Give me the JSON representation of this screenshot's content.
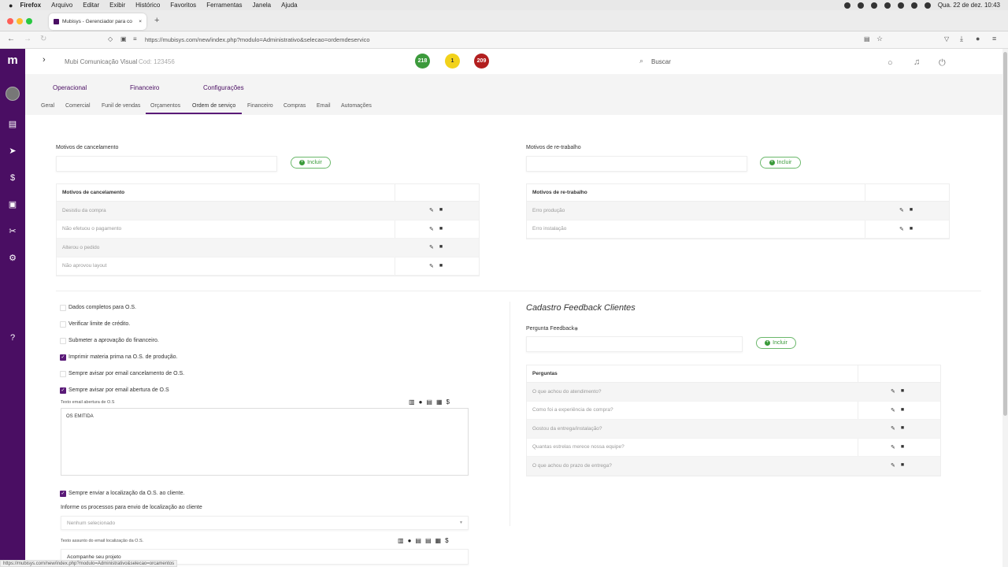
{
  "macos": {
    "app": "Firefox",
    "menus": [
      "Arquivo",
      "Editar",
      "Exibir",
      "Histórico",
      "Favoritos",
      "Ferramentas",
      "Janela",
      "Ajuda"
    ],
    "datetime": "Qua. 22 de dez.  10:43"
  },
  "browser": {
    "tab_title": "Mubisys - Gerenciador para co",
    "url": "https://mubisys.com/new/index.php?modulo=Administrativo&selecao=ordemdeservico",
    "status_url": "https://mubisys.com/new/index.php?modulo=Administrativo&selecao=orcamentos"
  },
  "header": {
    "company": "Mubi Comunicação Visual",
    "code": "Cod: 123456",
    "badges": [
      {
        "value": "218",
        "color": "#3c9a3c"
      },
      {
        "value": "1",
        "color": "#f2d21b"
      },
      {
        "value": "209",
        "color": "#b21f1f"
      }
    ],
    "search_label": "Buscar"
  },
  "topnav": [
    "Operacional",
    "Financeiro",
    "Configurações"
  ],
  "subnav": [
    "Geral",
    "Comercial",
    "Funil de vendas",
    "Orçamentos",
    "Ordem de serviço",
    "Financeiro",
    "Compras",
    "Email",
    "Automações"
  ],
  "active_subnav": "Ordem de serviço",
  "colors": {
    "brand": "#4a0e63",
    "accent": "#5a1a78",
    "success": "#3a9a3a"
  },
  "cancel": {
    "label": "Motivos de cancelamento",
    "button": "Incluir",
    "table_header": "Motivos de cancelamento",
    "rows": [
      "Desistiu da compra",
      "Não efetuou o pagamento",
      "Alterou o pedido",
      "Não aprovou layout"
    ]
  },
  "rework": {
    "label": "Motivos de re-trabalho",
    "button": "Incluir",
    "table_header": "Motivos de re-trabalho",
    "rows": [
      "Erro produção",
      "Erro instalação"
    ]
  },
  "options": [
    {
      "label": "Dados completos para O.S.",
      "checked": false
    },
    {
      "label": "Verificar limite de crédito.",
      "checked": false
    },
    {
      "label": "Submeter a aprovação do financeiro.",
      "checked": false
    },
    {
      "label": "Imprimir materia prima na O.S. de produção.",
      "checked": true
    },
    {
      "label": "Sempre avisar por email cancelamento de O.S.",
      "checked": false
    },
    {
      "label": "Sempre avisar por email abertura de O.S",
      "checked": true
    }
  ],
  "email_open": {
    "label": "Texto email abertura de O.S",
    "value": "OS EMITIDA"
  },
  "location": {
    "checkbox_label": "Sempre enviar a localização da O.S. ao cliente.",
    "processes_label": "Informe os processos para envio de localização ao cliente",
    "select_value": "Nenhum selecionado",
    "subject_label": "Texto assunto do email localização da O.S.",
    "subject_value": "Acompanhe seu projeto"
  },
  "feedback": {
    "title": "Cadastro Feedback Clientes",
    "question_label": "Pergunta Feedback",
    "button": "Incluir",
    "table_header": "Perguntas",
    "rows": [
      "O que achou do atendimento?",
      "Como foi a experiência de compra?",
      "Gostou da entrega/instalação?",
      "Quantas estrelas merece nossa equipe?",
      "O que achou do prazo de entrega?"
    ]
  }
}
